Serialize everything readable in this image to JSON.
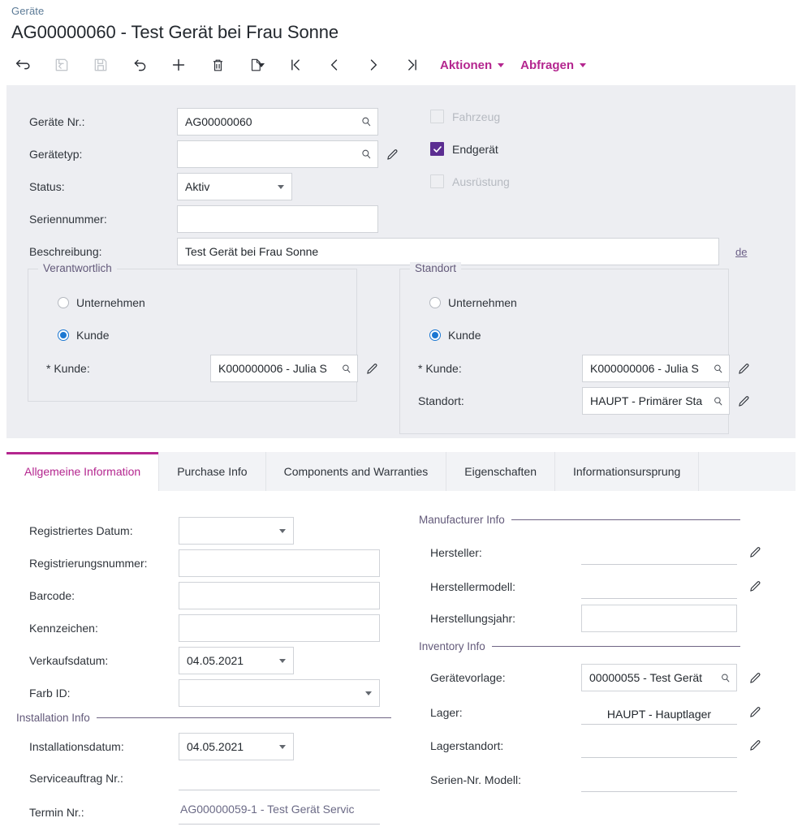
{
  "header": {
    "breadcrumb": "Geräte",
    "title": "AG00000060 - Test Gerät bei Frau Sonne"
  },
  "toolbar": {
    "back_icon": "back-arrow-icon",
    "save_close_icon": "save-and-close-icon",
    "save_icon": "save-icon",
    "undo_icon": "undo-icon",
    "add_icon": "plus-icon",
    "delete_icon": "trash-icon",
    "copy_icon": "copy-paste-icon",
    "first_icon": "first-record-icon",
    "prev_icon": "previous-record-icon",
    "next_icon": "next-record-icon",
    "last_icon": "last-record-icon",
    "actions_label": "Aktionen",
    "queries_label": "Abfragen",
    "accent_color": "#b4268f"
  },
  "top_form": {
    "fields": [
      {
        "label": "Geräte Nr.:",
        "value": "AG00000060",
        "has_search": true,
        "has_pencil": false
      },
      {
        "label": "Gerätetyp:",
        "value": "",
        "has_search": true,
        "has_pencil": true
      },
      {
        "label": "Status:",
        "value": "Aktiv",
        "is_select": true
      },
      {
        "label": "Seriennummer:",
        "value": ""
      },
      {
        "label": "Beschreibung:",
        "value": "Test Gerät bei Frau Sonne"
      }
    ],
    "de_link": "de",
    "checkboxes": [
      {
        "label": "Fahrzeug",
        "checked": false,
        "disabled": true
      },
      {
        "label": "Endgerät",
        "checked": true,
        "disabled": false
      },
      {
        "label": "Ausrüstung",
        "checked": false,
        "disabled": true
      }
    ],
    "responsible_group": {
      "title": "Verantwortlich",
      "radio_company": "Unternehmen",
      "radio_customer": "Kunde",
      "selected": "Kunde",
      "customer_label": "* Kunde:",
      "customer_value": "K000000006 - Julia S"
    },
    "location_group": {
      "title": "Standort",
      "radio_company": "Unternehmen",
      "radio_customer": "Kunde",
      "selected": "Kunde",
      "customer_label": "* Kunde:",
      "customer_value": "K000000006 - Julia S",
      "location_label": "Standort:",
      "location_value": "HAUPT - Primärer Sta"
    }
  },
  "tabs": [
    {
      "label": "Allgemeine Information",
      "active": true
    },
    {
      "label": "Purchase Info",
      "active": false
    },
    {
      "label": "Components and Warranties",
      "active": false
    },
    {
      "label": "Eigenschaften",
      "active": false
    },
    {
      "label": "Informationsursprung",
      "active": false
    }
  ],
  "tab_content": {
    "left": {
      "fields": [
        {
          "label": "Registriertes Datum:",
          "value": "",
          "is_select": true
        },
        {
          "label": "Registrierungsnummer:",
          "value": ""
        },
        {
          "label": "Barcode:",
          "value": ""
        },
        {
          "label": "Kennzeichen:",
          "value": ""
        },
        {
          "label": "Verkaufsdatum:",
          "value": "04.05.2021",
          "is_select": true
        },
        {
          "label": "Farb ID:",
          "value": "",
          "is_select": true
        }
      ],
      "installation_section": {
        "title": "Installation Info",
        "fields": [
          {
            "label": "Installationsdatum:",
            "value": "04.05.2021",
            "is_select": true
          },
          {
            "label": "Serviceauftrag Nr.:",
            "value": ""
          },
          {
            "label": "Termin Nr.:",
            "value": "AG00000059-1 - Test Gerät Servic",
            "is_link": true
          }
        ]
      }
    },
    "right": {
      "manufacturer_section": {
        "title": "Manufacturer Info",
        "fields": [
          {
            "label": "Hersteller:",
            "value": "",
            "underline": true,
            "has_pencil": true
          },
          {
            "label": "Herstellermodell:",
            "value": "",
            "underline": true,
            "has_pencil": true
          },
          {
            "label": "Herstellungsjahr:",
            "value": "",
            "underline": false,
            "has_pencil": false
          }
        ]
      },
      "inventory_section": {
        "title": "Inventory Info",
        "fields": [
          {
            "label": "Gerätevorlage:",
            "value": "00000055 - Test Gerät",
            "boxed": true,
            "has_search": true,
            "has_pencil": true
          },
          {
            "label": "Lager:",
            "value": "HAUPT - Hauptlager",
            "underline": true,
            "has_pencil": true
          },
          {
            "label": "Lagerstandort:",
            "value": "",
            "underline": true,
            "has_pencil": true
          },
          {
            "label": "Serien-Nr. Modell:",
            "value": "",
            "underline": true,
            "has_pencil": false
          }
        ]
      }
    }
  }
}
